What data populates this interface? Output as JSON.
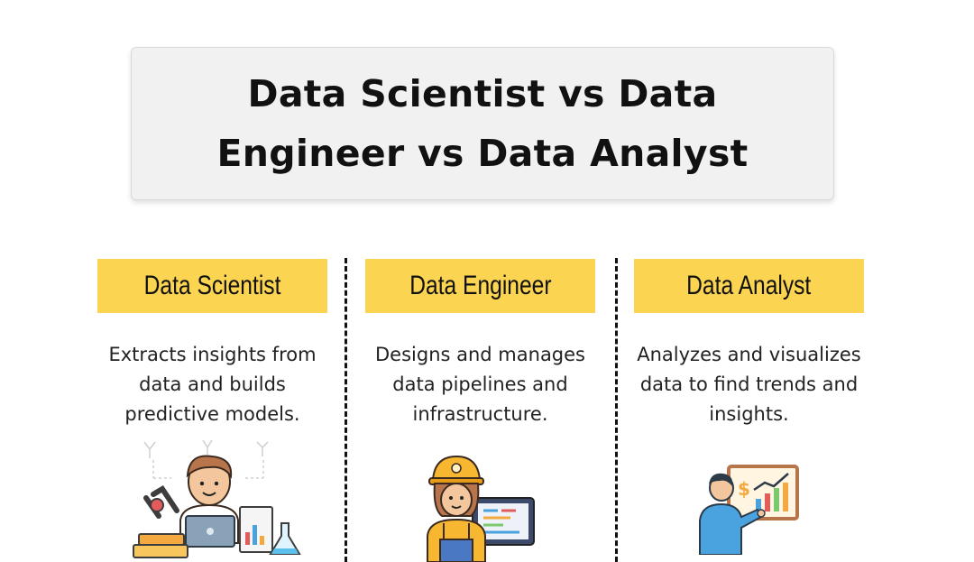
{
  "title": {
    "line1": "Data Scientist vs Data",
    "line2": "Engineer vs Data Analyst"
  },
  "columns": [
    {
      "label": "Data Scientist",
      "description": [
        "Extracts insights from",
        "data and builds",
        "predictive models."
      ],
      "icon": "data-scientist-illustration"
    },
    {
      "label": "Data Engineer",
      "description": [
        "Designs and manages",
        "data pipelines and",
        "infrastructure."
      ],
      "icon": "data-engineer-illustration"
    },
    {
      "label": "Data Analyst",
      "description": [
        "Analyzes and visualizes",
        "data to find trends and",
        "insights."
      ],
      "icon": "data-analyst-illustration"
    }
  ],
  "colors": {
    "label_bg": "#fbd451",
    "title_bg": "#f1f1f1",
    "text": "#111111"
  }
}
